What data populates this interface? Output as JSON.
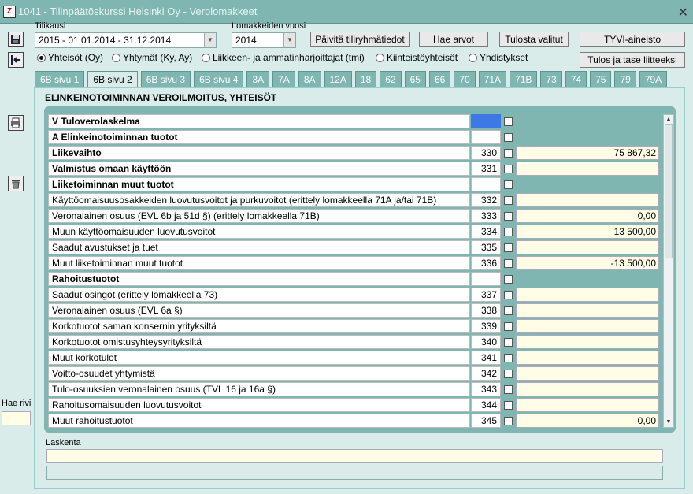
{
  "window": {
    "title": "1041 - Tilinpäätöskurssi Helsinki Oy - Verolomakkeet",
    "icon_text": "Z"
  },
  "toolbar": {
    "tilikausi_label": "Tilikausi",
    "tilikausi_value": "2015 - 01.01.2014 - 31.12.2014",
    "vuosi_label": "Lomakkeiden vuosi",
    "vuosi_value": "2014",
    "btn_paivita": "Päivitä tiliryhmätiedot",
    "btn_hae": "Hae arvot",
    "btn_tulosta": "Tulosta valitut",
    "btn_tyvi": "TYVI-aineisto",
    "btn_tulos_tase": "Tulos ja tase liitteeksi"
  },
  "radios": [
    {
      "label": "Yhteisöt (Oy)",
      "selected": true
    },
    {
      "label": "Yhtymät (Ky, Ay)",
      "selected": false
    },
    {
      "label": "Liikkeen- ja ammatinharjoittajat (tmi)",
      "selected": false
    },
    {
      "label": "Kiinteistöyhteisöt",
      "selected": false
    },
    {
      "label": "Yhdistykset",
      "selected": false
    }
  ],
  "tabs": [
    "6B sivu 1",
    "6B sivu 2",
    "6B sivu 3",
    "6B sivu 4",
    "3A",
    "7A",
    "8A",
    "12A",
    "18",
    "62",
    "65",
    "66",
    "70",
    "71A",
    "71B",
    "73",
    "74",
    "75",
    "79",
    "79A"
  ],
  "active_tab": "6B sivu 2",
  "panel_title": "ELINKEINOTOIMINNAN VEROILMOITUS, YHTEISÖT",
  "rows": [
    {
      "desc": "V  Tuloverolaskelma",
      "code": "",
      "value": "",
      "bold": true,
      "kind": "header-blue"
    },
    {
      "desc": "A  Elinkeinotoiminnan tuotot",
      "code": "",
      "value": "",
      "bold": true,
      "kind": "header"
    },
    {
      "desc": "Liikevaihto",
      "code": "330",
      "value": "75 867,32",
      "bold": true,
      "kind": "input"
    },
    {
      "desc": "Valmistus omaan käyttöön",
      "code": "331",
      "value": "",
      "bold": true,
      "kind": "input"
    },
    {
      "desc": "Liiketoiminnan muut tuotot",
      "code": "",
      "value": "",
      "bold": true,
      "kind": "header"
    },
    {
      "desc": "Käyttöomaisuusosakkeiden luovutusvoitot ja purkuvoitot (erittely lomakkeella 71A ja/tai 71B)",
      "code": "332",
      "value": "",
      "bold": false,
      "kind": "input"
    },
    {
      "desc": "Veronalainen osuus (EVL 6b ja 51d §) (erittely lomakkeella 71B)",
      "code": "333",
      "value": "0,00",
      "bold": false,
      "kind": "input"
    },
    {
      "desc": "Muun käyttöomaisuuden luovutusvoitot",
      "code": "334",
      "value": "13 500,00",
      "bold": false,
      "kind": "input"
    },
    {
      "desc": "Saadut avustukset ja tuet",
      "code": "335",
      "value": "",
      "bold": false,
      "kind": "input"
    },
    {
      "desc": "Muut liiketoiminnan muut tuotot",
      "code": "336",
      "value": "-13 500,00",
      "bold": false,
      "kind": "input"
    },
    {
      "desc": "Rahoitustuotot",
      "code": "",
      "value": "",
      "bold": true,
      "kind": "header"
    },
    {
      "desc": "Saadut osingot (erittely lomakkeella 73)",
      "code": "337",
      "value": "",
      "bold": false,
      "kind": "input"
    },
    {
      "desc": "Veronalainen osuus (EVL 6a §)",
      "code": "338",
      "value": "",
      "bold": false,
      "kind": "input"
    },
    {
      "desc": "Korkotuotot saman konsernin yrityksiltä",
      "code": "339",
      "value": "",
      "bold": false,
      "kind": "input"
    },
    {
      "desc": "Korkotuotot omistusyhteysyrityksiltä",
      "code": "340",
      "value": "",
      "bold": false,
      "kind": "input"
    },
    {
      "desc": "Muut korkotulot",
      "code": "341",
      "value": "",
      "bold": false,
      "kind": "input"
    },
    {
      "desc": "Voitto-osuudet yhtymistä",
      "code": "342",
      "value": "",
      "bold": false,
      "kind": "input"
    },
    {
      "desc": "Tulo-osuuksien veronalainen osuus (TVL 16 ja 16a §)",
      "code": "343",
      "value": "",
      "bold": false,
      "kind": "input"
    },
    {
      "desc": "Rahoitusomaisuuden luovutusvoitot",
      "code": "344",
      "value": "",
      "bold": false,
      "kind": "input"
    },
    {
      "desc": "Muut rahoitustuotot",
      "code": "345",
      "value": "0,00",
      "bold": false,
      "kind": "input"
    }
  ],
  "laskenta_label": "Laskenta",
  "hae_rivi_label": "Hae rivi",
  "icons": [
    "save-icon",
    "exit-icon",
    "print-icon",
    "delete-icon",
    "close-icon"
  ]
}
